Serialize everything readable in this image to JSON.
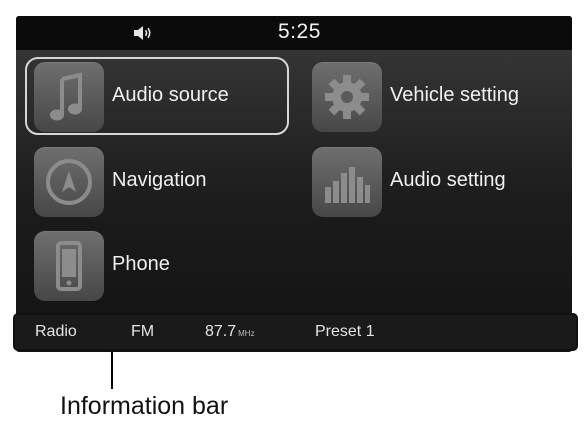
{
  "status_bar": {
    "volume_icon": "speaker-icon",
    "clock": "5:25"
  },
  "menu": {
    "items": [
      {
        "label": "Audio source",
        "icon": "music-note-icon",
        "selected": true
      },
      {
        "label": "Vehicle setting",
        "icon": "gear-icon",
        "selected": false
      },
      {
        "label": "Navigation",
        "icon": "compass-icon",
        "selected": false
      },
      {
        "label": "Audio setting",
        "icon": "equalizer-icon",
        "selected": false
      },
      {
        "label": "Phone",
        "icon": "phone-icon",
        "selected": false
      }
    ]
  },
  "info_bar": {
    "source": "Radio",
    "band": "FM",
    "frequency": "87.7",
    "frequency_unit": "MHz",
    "preset": "Preset 1"
  },
  "callout": {
    "label": "Information bar"
  },
  "colors": {
    "tile": "#5a5a5a",
    "text": "#f0f0f0",
    "status_bar": "#0b0b0b"
  }
}
